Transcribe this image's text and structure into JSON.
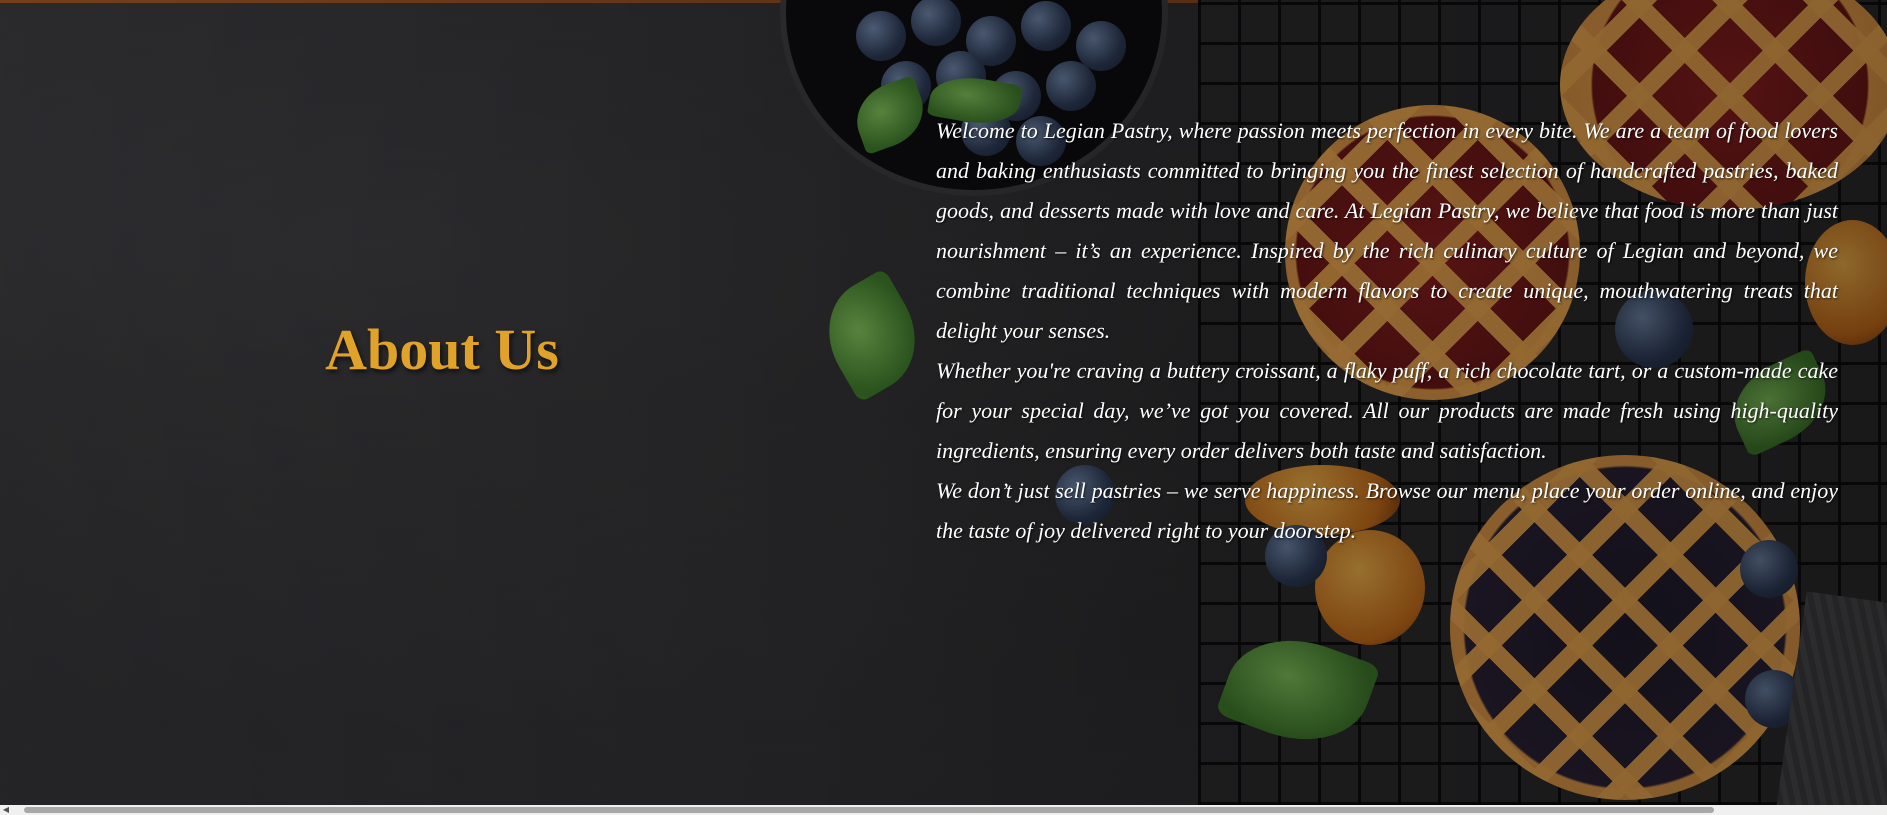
{
  "about": {
    "title": "About Us",
    "paragraphs": [
      "Welcome to Legian Pastry, where passion meets perfection in every bite. We are a team of food lovers and baking enthusiasts committed to bringing you the finest selection of handcrafted pastries, baked goods, and desserts made with love and care. At Legian Pastry, we believe that food is more than just nourishment – it’s an experience. Inspired by the rich culinary culture of Legian and beyond, we combine traditional techniques with modern flavors to create unique, mouthwatering treats that delight your senses.",
      "Whether you're craving a buttery croissant, a flaky puff, a rich chocolate tart, or a custom-made cake for your special day, we’ve got you covered. All our products are made fresh using high-quality ingredients, ensuring every order delivers both taste and satisfaction.",
      "We don’t just sell pastries – we serve happiness. Browse our menu, place your order online, and enjoy the taste of joy delivered right to your doorstep."
    ]
  },
  "colors": {
    "title": "#e1a229",
    "text": "#ffffff",
    "background": "#2a2a2d",
    "top_accent": "#8a4a22"
  },
  "icons": {
    "scroll_left": "scroll-left-arrow-icon"
  },
  "scrollbar": {
    "arrow_glyph": "◀"
  }
}
